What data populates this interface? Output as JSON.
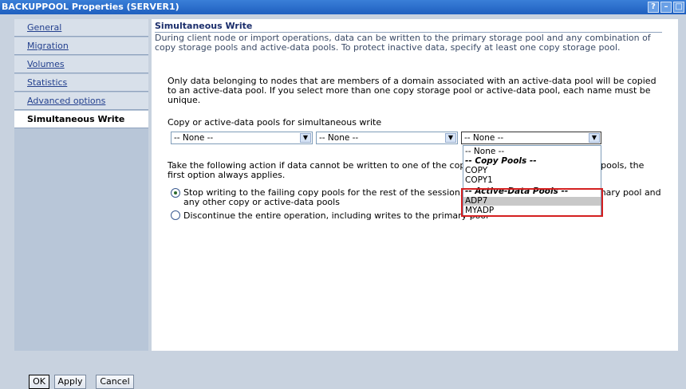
{
  "window": {
    "title": "BACKUPPOOL Properties (SERVER1)"
  },
  "sidebar": {
    "items": [
      {
        "label": "General"
      },
      {
        "label": "Migration"
      },
      {
        "label": "Volumes"
      },
      {
        "label": "Statistics"
      },
      {
        "label": "Advanced options"
      },
      {
        "label": "Simultaneous Write",
        "active": true
      }
    ]
  },
  "section": {
    "heading": "Simultaneous Write",
    "intro": "During client node or import operations, data can be written to the primary storage pool and any combination of copy storage pools and active-data pools. To protect inactive data, specify at least one copy storage pool.",
    "note": "Only data belonging to nodes that are members of a domain associated with an active-data pool will be copied to an active-data pool. If you select more than one copy storage pool or active-data pool, each name must be unique.",
    "pools_label": "Copy or active-data pools for simultaneous write",
    "selects": [
      {
        "value": "-- None --"
      },
      {
        "value": "-- None --"
      },
      {
        "value": "-- None --"
      }
    ],
    "action_text": "Take the following action if data cannot be written to one of the copy pools. For failing active-data pools, the first option always applies.",
    "option_stop": "Stop writing to the failing copy pools for the rest of the session, but continue writing to the primary pool and any other copy or active-data pools",
    "option_discontinue": "Discontinue the entire operation, including writes to the primary pool"
  },
  "dropdown": {
    "items": [
      {
        "label": "-- None --"
      },
      {
        "label": "-- Copy Pools --",
        "group": true
      },
      {
        "label": "COPY"
      },
      {
        "label": "COPY1"
      },
      {
        "label": "-- Active-Data Pools --",
        "group": true
      },
      {
        "label": "ADP7",
        "highlighted": true
      },
      {
        "label": "MYADP"
      }
    ]
  },
  "buttons": {
    "ok": "OK",
    "apply": "Apply",
    "cancel": "Cancel"
  },
  "window_controls": {
    "help": "?",
    "minimize": "–",
    "maximize": "□"
  }
}
